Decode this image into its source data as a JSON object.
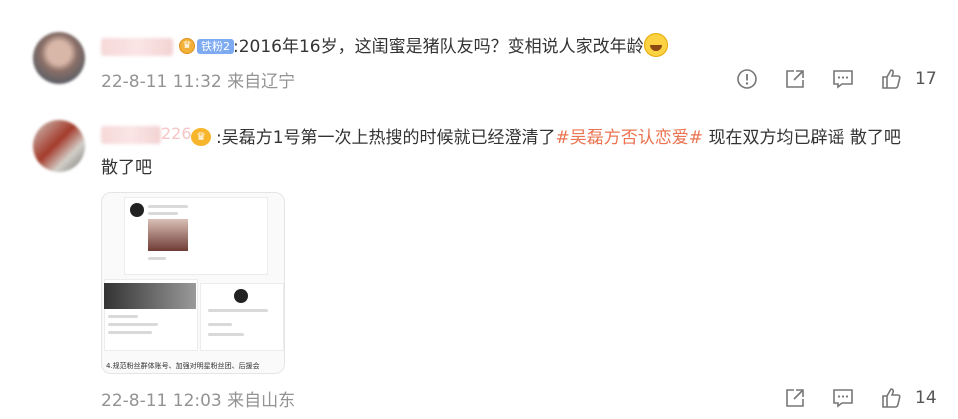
{
  "comments": [
    {
      "badge": {
        "icon": "crown-badge-icon",
        "label": "铁粉2"
      },
      "text_html_parts": {
        "text": ":2016年16岁，这闺蜜是猪队友吗？变相说人家改年龄",
        "emoji": "laughing-emoji"
      },
      "meta": "22-8-11 11:32 来自辽宁",
      "like_count": "17"
    },
    {
      "name_tail": "226",
      "badge": {
        "icon": "crown-icon"
      },
      "text_prefix": ":吴磊方1号第一次上热搜的时候就已经澄清了",
      "topic": "#吴磊方否认恋爱#",
      "text_suffix": " 现在双方均已辟谣 散了吧",
      "text_line2": "散了吧",
      "image_caption": "4.规范粉丝群体账号、加强对明星粉丝团、后援会",
      "meta": "22-8-11 12:03 来自山东",
      "like_count": "14"
    }
  ],
  "colors": {
    "topic": "#eb7350",
    "meta": "#939393",
    "badge": "#7eaaf2"
  }
}
